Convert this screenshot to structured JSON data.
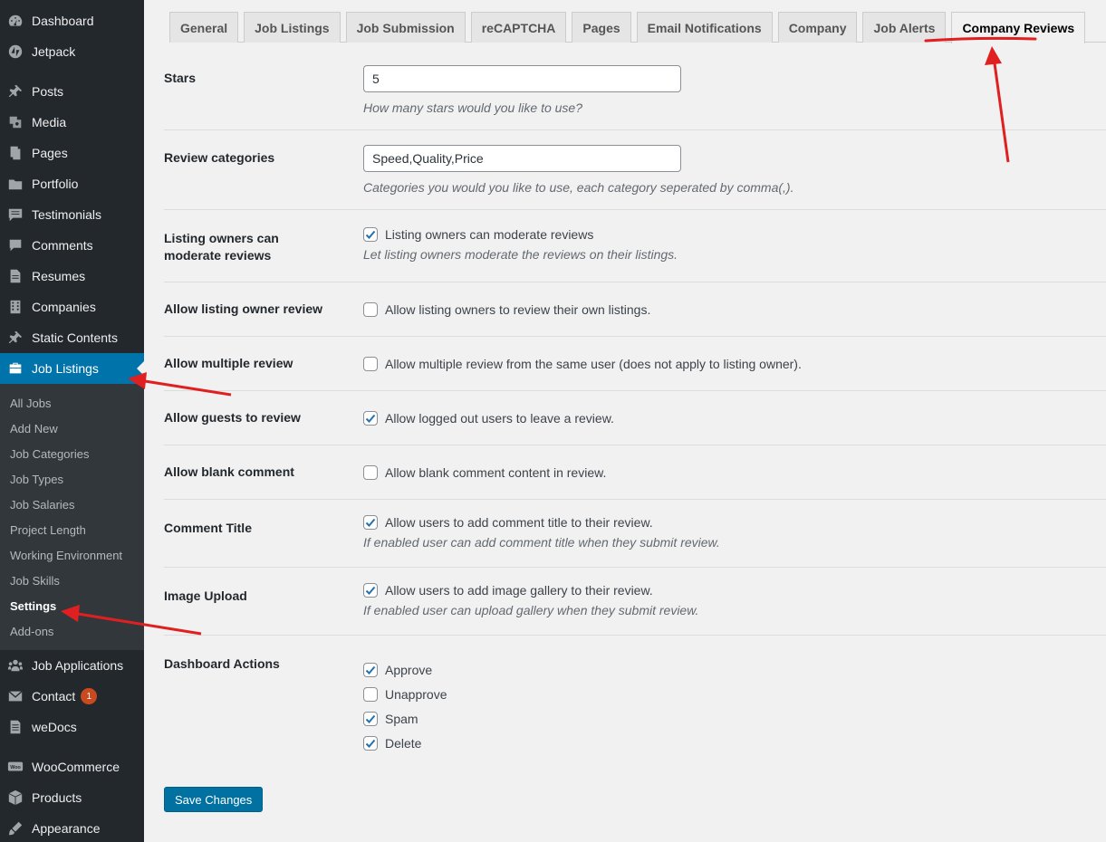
{
  "sidebar": {
    "menu": [
      {
        "label": "Dashboard",
        "icon": "dashboard-icon"
      },
      {
        "label": "Jetpack",
        "icon": "jetpack-icon"
      },
      {
        "label": "Posts",
        "icon": "pin-icon"
      },
      {
        "label": "Media",
        "icon": "media-icon"
      },
      {
        "label": "Pages",
        "icon": "pages-icon"
      },
      {
        "label": "Portfolio",
        "icon": "portfolio-icon"
      },
      {
        "label": "Testimonials",
        "icon": "testimonial-icon"
      },
      {
        "label": "Comments",
        "icon": "comment-icon"
      },
      {
        "label": "Resumes",
        "icon": "document-icon"
      },
      {
        "label": "Companies",
        "icon": "building-icon"
      },
      {
        "label": "Static Contents",
        "icon": "pin-icon"
      },
      {
        "label": "Job Listings",
        "icon": "briefcase-icon"
      }
    ],
    "submenu": [
      "All Jobs",
      "Add New",
      "Job Categories",
      "Job Types",
      "Job Salaries",
      "Project Length",
      "Working Environment",
      "Job Skills",
      "Settings",
      "Add-ons"
    ],
    "menu_bottom": [
      {
        "label": "Job Applications",
        "icon": "groups-icon"
      },
      {
        "label": "Contact",
        "icon": "mail-icon",
        "badge": "1"
      },
      {
        "label": "weDocs",
        "icon": "docs-icon"
      },
      {
        "label": "WooCommerce",
        "icon": "woocommerce-icon"
      },
      {
        "label": "Products",
        "icon": "box-icon"
      },
      {
        "label": "Appearance",
        "icon": "appearance-icon"
      }
    ]
  },
  "tabs": [
    "General",
    "Job Listings",
    "Job Submission",
    "reCAPTCHA",
    "Pages",
    "Email Notifications",
    "Company",
    "Job Alerts",
    "Company Reviews"
  ],
  "active_tab": "Company Reviews",
  "settings": {
    "stars": {
      "label": "Stars",
      "value": "5",
      "desc": "How many stars would you like to use?"
    },
    "categories": {
      "label": "Review categories",
      "value": "Speed,Quality,Price",
      "desc": "Categories you would you like to use, each category seperated by comma(,)."
    },
    "moderate": {
      "label": "Listing owners can moderate reviews",
      "text": "Listing owners can moderate reviews",
      "checked": true,
      "desc": "Let listing owners moderate the reviews on their listings."
    },
    "owner_review": {
      "label": "Allow listing owner review",
      "text": "Allow listing owners to review their own listings.",
      "checked": false
    },
    "multiple": {
      "label": "Allow multiple review",
      "text": "Allow multiple review from the same user (does not apply to listing owner).",
      "checked": false
    },
    "guests": {
      "label": "Allow guests to review",
      "text": "Allow logged out users to leave a review.",
      "checked": true
    },
    "blank": {
      "label": "Allow blank comment",
      "text": "Allow blank comment content in review.",
      "checked": false
    },
    "comment_title": {
      "label": "Comment Title",
      "text": "Allow users to add comment title to their review.",
      "checked": true,
      "desc": "If enabled user can add comment title when they submit review."
    },
    "image_upload": {
      "label": "Image Upload",
      "text": "Allow users to add image gallery to their review.",
      "checked": true,
      "desc": "If enabled user can upload gallery when they submit review."
    },
    "dashboard_actions": {
      "label": "Dashboard Actions",
      "options": [
        {
          "text": "Approve",
          "checked": true
        },
        {
          "text": "Unapprove",
          "checked": false
        },
        {
          "text": "Spam",
          "checked": true
        },
        {
          "text": "Delete",
          "checked": true
        }
      ]
    }
  },
  "save_label": "Save Changes",
  "colors": {
    "sidebar": "#23282d",
    "accent": "#0073aa",
    "annotation": "#e02020"
  }
}
